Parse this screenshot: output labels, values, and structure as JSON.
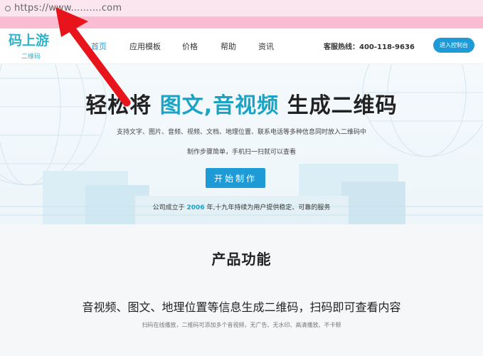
{
  "browser": {
    "url": "https://www..........com"
  },
  "header": {
    "logo": {
      "main": "码上游",
      "sub": "二维码"
    },
    "nav": [
      {
        "label": "首页",
        "active": true
      },
      {
        "label": "应用模板",
        "active": false
      },
      {
        "label": "价格",
        "active": false
      },
      {
        "label": "帮助",
        "active": false
      },
      {
        "label": "资讯",
        "active": false
      }
    ],
    "hotline": "客服热线：400-118-9636",
    "console_button": "进入控制台"
  },
  "hero": {
    "title_pre": "轻松将 ",
    "title_highlight": "图文,音视频",
    "title_post": " 生成二维码",
    "subtitle1": "支持文字、图片、音频、视频、文档、地理位置、联系电话等多种信息同时放入二维码中",
    "subtitle2": "制作步骤简单，手机扫一扫就可以查看",
    "start_button": "开始制作",
    "founded_pre": "公司成立于 ",
    "founded_year": "2006",
    "founded_post": " 年,十九年持续为用户提供稳定、可靠的服务"
  },
  "products": {
    "title": "产品功能",
    "subtitle": "音视频、图文、地理位置等信息生成二维码，扫码即可查看内容",
    "description": "扫码在线播放，二维码可添加多个音视频，无广告、无水印、高清播放、不卡顿"
  },
  "colors": {
    "accent": "#1e9ad6",
    "teal": "#1aa3c4",
    "annotation_arrow": "#e8141b",
    "url_bar": "#fbe6ef"
  },
  "icons": [
    "lock-icon",
    "red-annotation-arrow"
  ]
}
